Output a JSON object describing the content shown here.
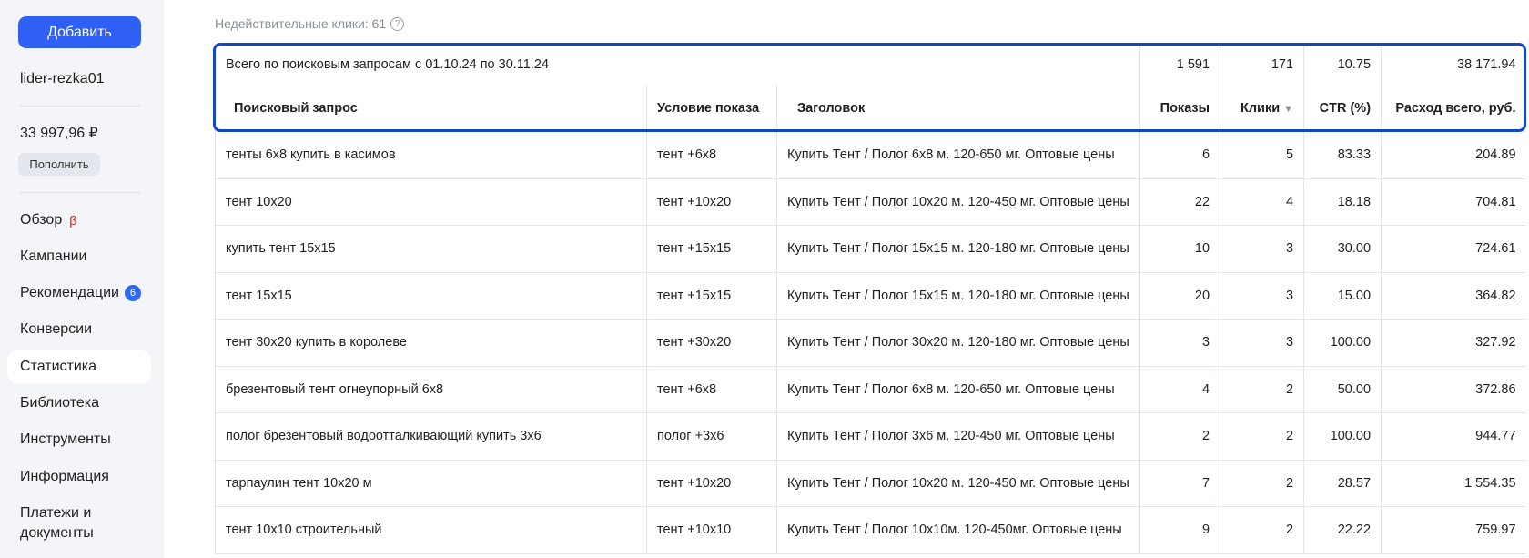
{
  "sidebar": {
    "add_button": "Добавить",
    "account": "lider-rezka01",
    "balance": "33 997,96 ₽",
    "topup_button": "Пополнить",
    "nav": [
      {
        "label": "Обзор",
        "beta": "β"
      },
      {
        "label": "Кампании"
      },
      {
        "label": "Рекомендации",
        "badge": "6"
      },
      {
        "label": "Конверсии"
      },
      {
        "label": "Статистика",
        "active": true
      },
      {
        "label": "Библиотека"
      },
      {
        "label": "Инструменты"
      },
      {
        "label": "Информация"
      },
      {
        "label": "Платежи и документы"
      }
    ]
  },
  "main": {
    "invalid_clicks": "Недействительные клики: 61",
    "help_icon": "?",
    "total_row": {
      "label": "Всего по поисковым запросам с 01.10.24 по 30.11.24",
      "shows": "1 591",
      "clicks": "171",
      "ctr": "10.75",
      "cost": "38 171.94"
    },
    "columns": {
      "query": "Поисковый запрос",
      "condition": "Условие показа",
      "title": "Заголовок",
      "shows": "Показы",
      "clicks": "Клики",
      "sort_icon": "▼",
      "ctr": "CTR (%)",
      "cost": "Расход всего, руб."
    },
    "rows": [
      {
        "query": "тенты 6х8 купить в касимов",
        "condition": "тент +6х8",
        "title": "Купить Тент / Полог 6х8 м. 120-650 мг. Оптовые цены",
        "shows": "6",
        "clicks": "5",
        "ctr": "83.33",
        "cost": "204.89"
      },
      {
        "query": "тент 10х20",
        "condition": "тент +10х20",
        "title": "Купить Тент / Полог 10х20 м. 120-450 мг. Оптовые цены",
        "shows": "22",
        "clicks": "4",
        "ctr": "18.18",
        "cost": "704.81"
      },
      {
        "query": "купить тент 15х15",
        "condition": "тент +15х15",
        "title": "Купить Тент / Полог 15х15 м. 120-180 мг. Оптовые цены",
        "shows": "10",
        "clicks": "3",
        "ctr": "30.00",
        "cost": "724.61"
      },
      {
        "query": "тент 15х15",
        "condition": "тент +15х15",
        "title": "Купить Тент / Полог 15х15 м. 120-180 мг. Оптовые цены",
        "shows": "20",
        "clicks": "3",
        "ctr": "15.00",
        "cost": "364.82"
      },
      {
        "query": "тент 30х20 купить в королеве",
        "condition": "тент +30х20",
        "title": "Купить Тент / Полог 30х20 м. 120-180 мг. Оптовые цены",
        "shows": "3",
        "clicks": "3",
        "ctr": "100.00",
        "cost": "327.92"
      },
      {
        "query": "брезентовый тент огнеупорный 6х8",
        "condition": "тент +6х8",
        "title": "Купить Тент / Полог 6х8 м. 120-650 мг. Оптовые цены",
        "shows": "4",
        "clicks": "2",
        "ctr": "50.00",
        "cost": "372.86"
      },
      {
        "query": "полог брезентовый водоотталкивающий купить 3х6",
        "condition": "полог +3х6",
        "title": "Купить Тент / Полог 3х6 м. 120-450 мг. Оптовые цены",
        "shows": "2",
        "clicks": "2",
        "ctr": "100.00",
        "cost": "944.77"
      },
      {
        "query": "тарпаулин тент 10х20 м",
        "condition": "тент +10х20",
        "title": "Купить Тент / Полог 10х20 м. 120-450 мг. Оптовые цены",
        "shows": "7",
        "clicks": "2",
        "ctr": "28.57",
        "cost": "1 554.35"
      },
      {
        "query": "тент 10х10 строительный",
        "condition": "тент +10х10",
        "title": "Купить Тент / Полог 10х10м. 120-450мг. Оптовые цены",
        "shows": "9",
        "clicks": "2",
        "ctr": "22.22",
        "cost": "759.97"
      }
    ]
  }
}
